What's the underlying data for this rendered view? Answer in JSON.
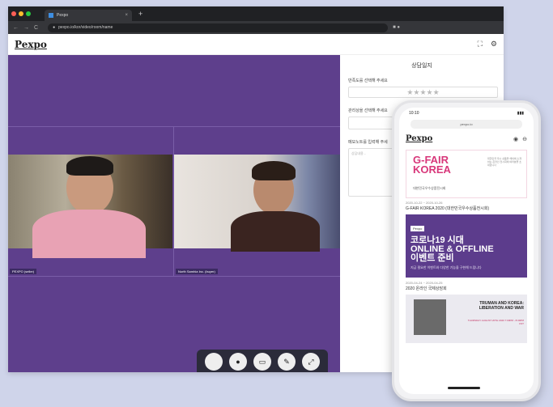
{
  "browser": {
    "tab_title": "Pexpo",
    "tab_close": "×",
    "new_tab": "+",
    "url": "pexpo.io/kor/video/room/name",
    "nav_back": "←",
    "nav_forward": "→",
    "nav_reload": "C",
    "traffic_colors": [
      "#ff5f57",
      "#febc2e",
      "#28c840"
    ]
  },
  "app": {
    "logo": "Pexpo",
    "fullscreen_icon": "⛶",
    "settings_icon": "⚙"
  },
  "video": {
    "background": "#5e3f8c",
    "participants": [
      {
        "label": "PEXPO (seller)"
      },
      {
        "label": "North Samhia Inc. (buyer)"
      }
    ],
    "toolbar_icons": [
      "●",
      "●",
      "▭",
      "✎",
      "⤢"
    ]
  },
  "panel": {
    "title": "상담일지",
    "rating_label": "만족도를 선택해 주세요",
    "stars": "★★★★★",
    "select_label": "관리상을 선택해 주세요",
    "memo_label": "메모노트를 입력해 주세",
    "memo_placeholder": "상담내용..."
  },
  "phone": {
    "time": "10:10",
    "signal": "▮▮▮",
    "url": "pexpo.io",
    "logo": "Pexpo",
    "banner1": {
      "title_line1": "G-FAIR",
      "title_line2": "KOREA",
      "subtitle": "대한민국우수상품전시회",
      "side_text": "대한민국 우수 상품을 해외에 소개하는 온라인 전시회에 여러분을 초대합니다"
    },
    "item1_meta": "2020-10-22 ~ 2020-10-26",
    "item1_title": "G-FAIR KOREA 2020 (대한민국우수상품전시회)",
    "banner2": {
      "tag": "Pexpo",
      "title_line1": "코로나19 시대",
      "title_line2": "ONLINE & OFFLINE",
      "title_line3": "이벤트 준비",
      "subtitle": "지금 필요한 이벤트와 다양한 기능을 구현해 드립니다"
    },
    "item2_meta": "2020-04-24 ~ 2020-04-25",
    "item2_title": "2020 온라인 국제상담회",
    "banner3": {
      "title": "TRUMAN AND KOREA: LIBERATION AND WAR",
      "date": "THURSDAY AUGUST 20TH 2020 7:00PM - 8:30PM CST"
    }
  }
}
